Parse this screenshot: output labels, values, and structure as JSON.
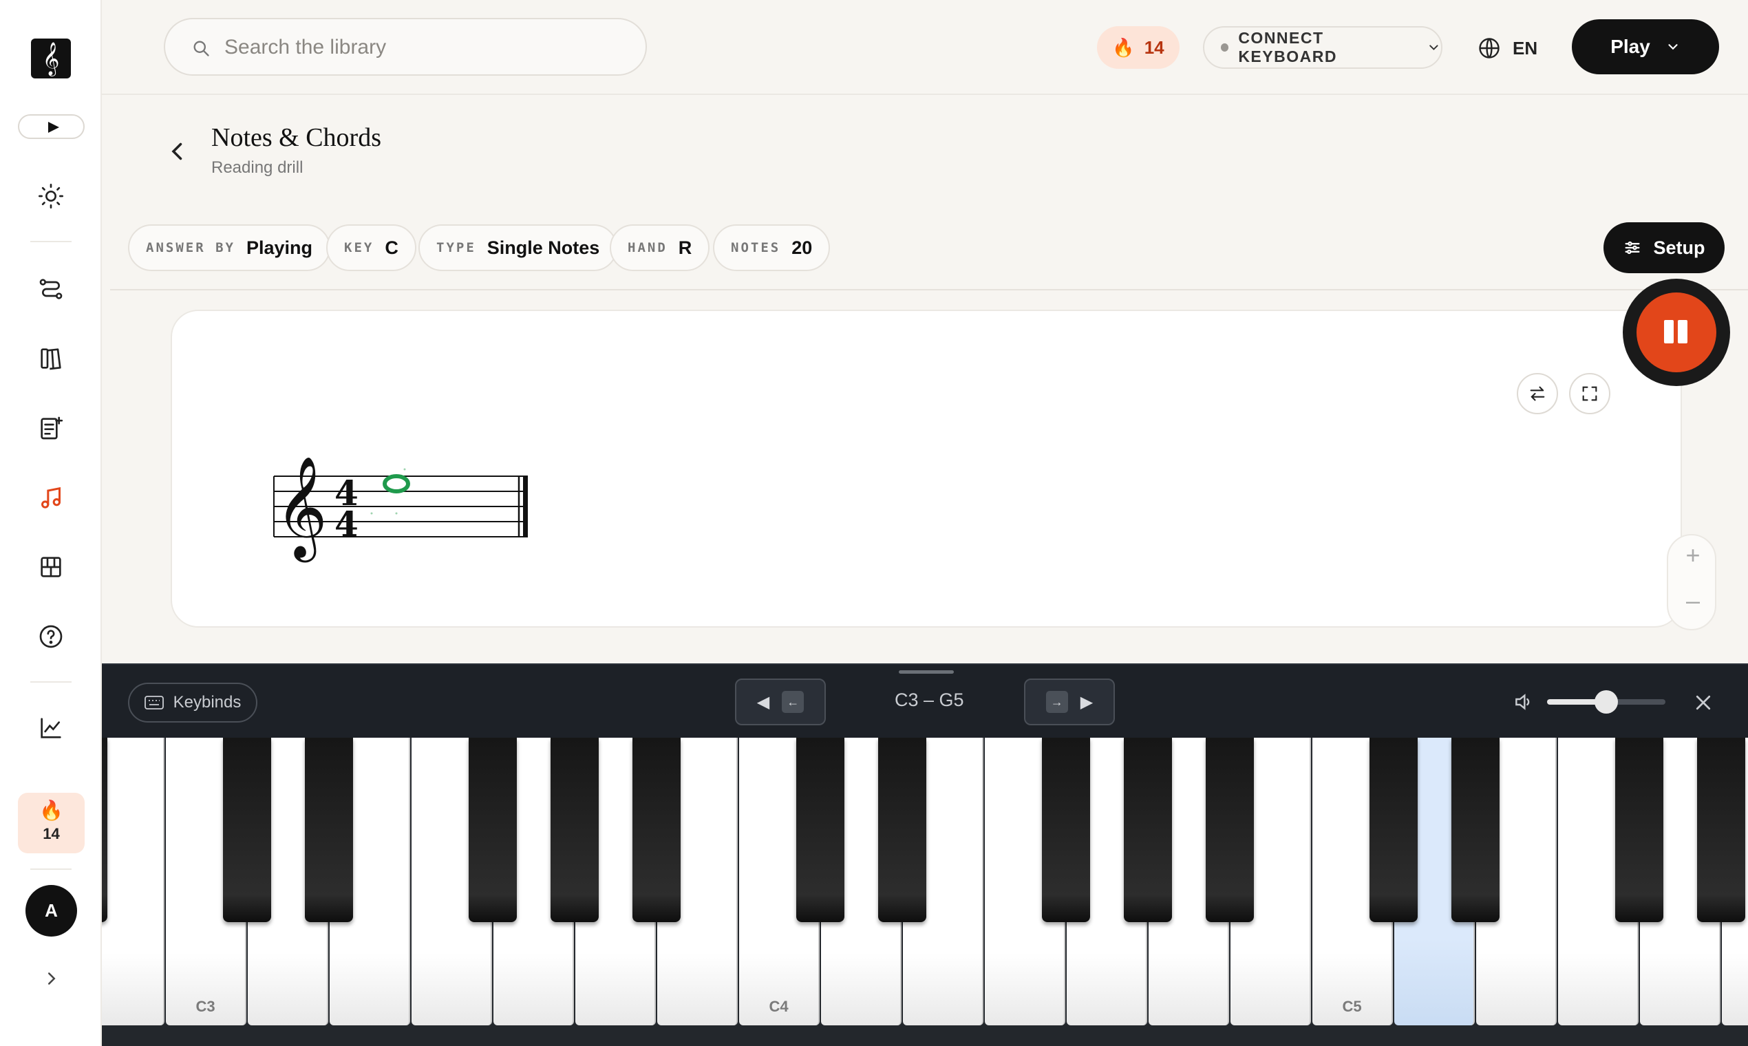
{
  "app": {
    "logo_glyph": "𝄞",
    "streak_count": "14"
  },
  "sidebar": {
    "items": [
      {
        "name": "theme",
        "icon": "sun-icon"
      },
      {
        "name": "learning-path",
        "icon": "path-icon"
      },
      {
        "name": "library",
        "icon": "library-icon"
      },
      {
        "name": "sheet-generator",
        "icon": "sheet-add-icon"
      },
      {
        "name": "practice",
        "icon": "music-note-icon",
        "active": true
      },
      {
        "name": "piano",
        "icon": "piano-icon"
      },
      {
        "name": "help",
        "icon": "help-icon"
      },
      {
        "name": "progress",
        "icon": "chart-icon"
      }
    ],
    "avatar_letter": "A"
  },
  "topbar": {
    "search_placeholder": "Search the library",
    "streak": "14",
    "connect_label": "CONNECT KEYBOARD",
    "language": "EN",
    "play_label": "Play"
  },
  "header": {
    "title": "Notes & Chords",
    "subtitle": "Reading drill"
  },
  "settings": {
    "chips": [
      {
        "key": "ANSWER BY",
        "value": "Playing"
      },
      {
        "key": "KEY",
        "value": "C"
      },
      {
        "key": "TYPE",
        "value": "Single Notes"
      },
      {
        "key": "HAND",
        "value": "R"
      },
      {
        "key": "NOTES",
        "value": "20"
      }
    ],
    "setup_label": "Setup"
  },
  "stave": {
    "clef": "treble",
    "time_signature": [
      "4",
      "4"
    ],
    "current_note": "E5",
    "note_color": "#1f9a4c"
  },
  "piano": {
    "keybinds_label": "Keybinds",
    "prev_key": "←",
    "next_key": "→",
    "range": "C3 – G5",
    "volume": 0.5,
    "white_key_labels": {
      "C3": "C3",
      "C4": "C4",
      "C5": "C5"
    },
    "highlighted_key": "D5"
  },
  "colors": {
    "accent": "#e2461a",
    "highlight_key": "#dbe9fb"
  }
}
